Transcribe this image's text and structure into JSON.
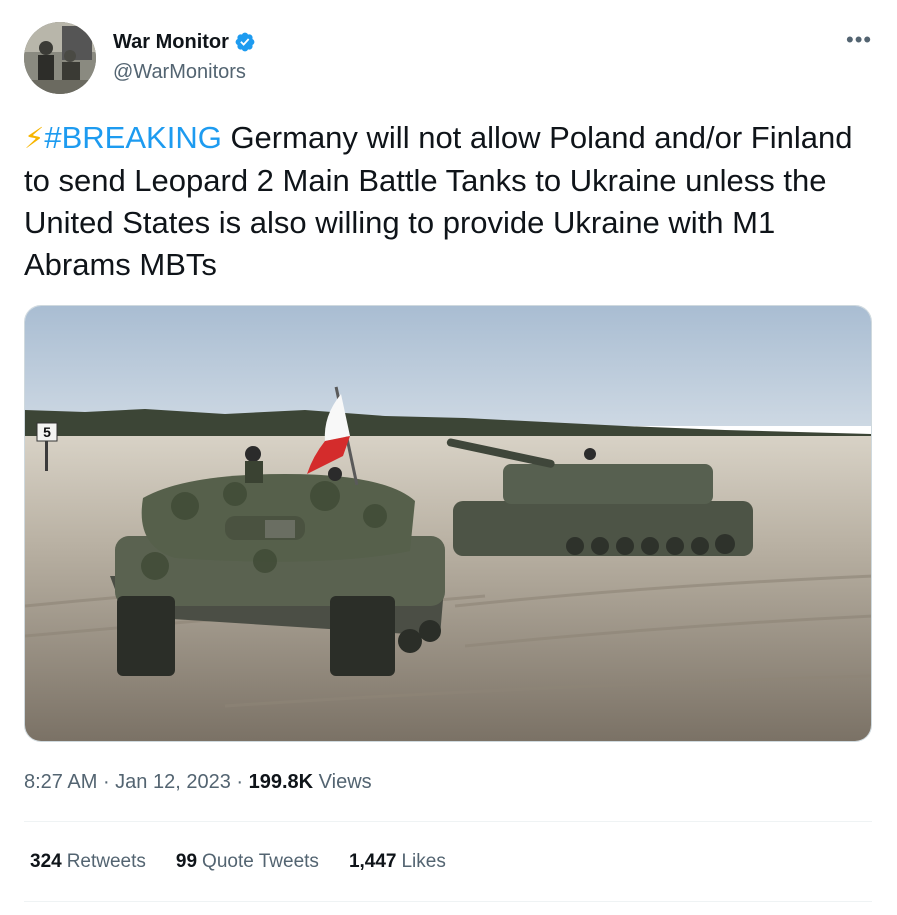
{
  "author": {
    "display_name": "War Monitor",
    "handle": "@WarMonitors",
    "verified_icon": "verified-badge-icon",
    "avatar_icon": "avatar-photo"
  },
  "more_button": {
    "icon": "more-dots-icon",
    "label": "•••"
  },
  "tweet": {
    "emoji": "⚡",
    "hashtag": "#BREAKING",
    "body": " Germany will not allow Poland and/or Finland to send Leopard 2 Main Battle Tanks to Ukraine unless the United States is also willing to provide Ukraine with M1 Abrams MBTs"
  },
  "media": {
    "icon": "photo-tanks-in-field",
    "sign_text": "5"
  },
  "meta": {
    "time": "8:27 AM",
    "sep1": " · ",
    "date": "Jan 12, 2023",
    "sep2": " · ",
    "views_count": "199.8K",
    "views_label": " Views"
  },
  "stats": {
    "retweets_count": "324",
    "retweets_label": "Retweets",
    "quotes_count": "99",
    "quotes_label": "Quote Tweets",
    "likes_count": "1,447",
    "likes_label": "Likes"
  },
  "colors": {
    "accent": "#1d9bf0",
    "text": "#0f1419",
    "secondary": "#536471",
    "divider": "#eff3f4"
  }
}
